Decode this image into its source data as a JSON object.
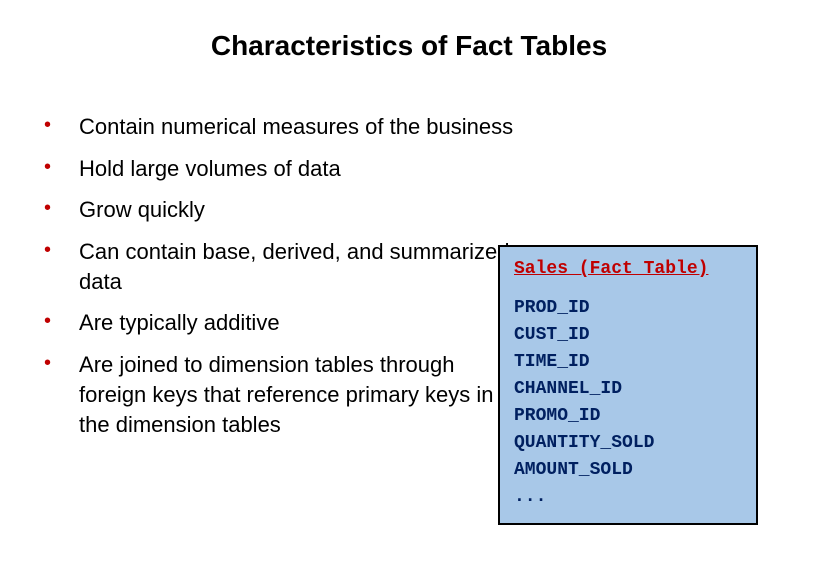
{
  "title": "Characteristics of Fact Tables",
  "bullets": [
    "Contain numerical measures of the business",
    "Hold large volumes of data",
    "Grow quickly",
    "Can contain base, derived, and summarized data",
    "Are typically additive",
    "Are joined to dimension tables through foreign keys that reference primary keys in the dimension tables"
  ],
  "fact_table": {
    "title": "Sales (Fact Table)",
    "columns": "PROD_ID\nCUST_ID\nTIME_ID\nCHANNEL_ID\nPROMO_ID\nQUANTITY_SOLD\nAMOUNT_SOLD\n..."
  }
}
